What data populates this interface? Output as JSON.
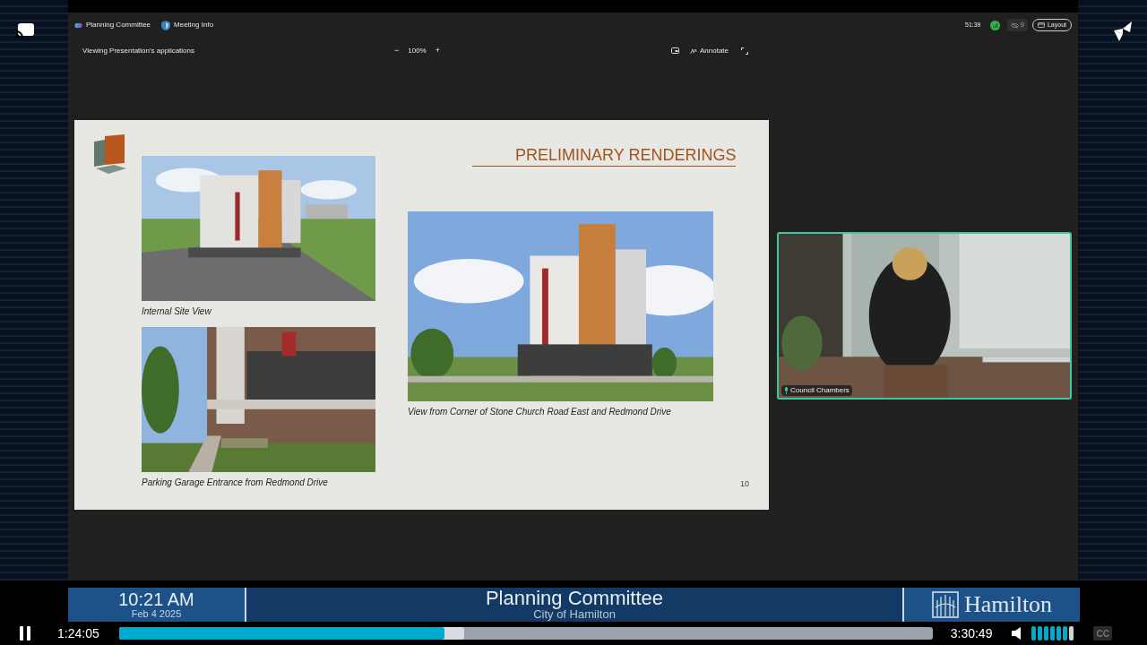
{
  "meeting": {
    "title": "Planning Committee",
    "info": "Meeting Info",
    "elapsed": "51:39",
    "participants": "9",
    "layout_button": "Layout",
    "sharing_label": "Viewing Presentation's applications",
    "zoom_out": "−",
    "zoom": "100%",
    "zoom_in": "+",
    "annotate": "Annotate"
  },
  "slide": {
    "title": "PRELIMINARY RENDERINGS",
    "images": [
      {
        "caption": "Internal Site View"
      },
      {
        "caption": "Parking Garage Entrance from Redmond Drive"
      },
      {
        "caption": "View from Corner of Stone Church Road East and Redmond Drive"
      }
    ],
    "page_number": "10"
  },
  "video_tile": {
    "label": "Council Chambers"
  },
  "banner": {
    "time": "10:21 AM",
    "date": "Feb 4 2025",
    "title": "Planning Committee",
    "subtitle": "City of Hamilton",
    "logo_text": "Hamilton"
  },
  "player": {
    "playing": true,
    "current_time": "1:24:05",
    "duration": "3:30:49",
    "progress": {
      "level": 0.4
    },
    "buffered": {
      "level": 0.424
    },
    "volume": {
      "level": 0.86
    },
    "cc": "CC"
  }
}
